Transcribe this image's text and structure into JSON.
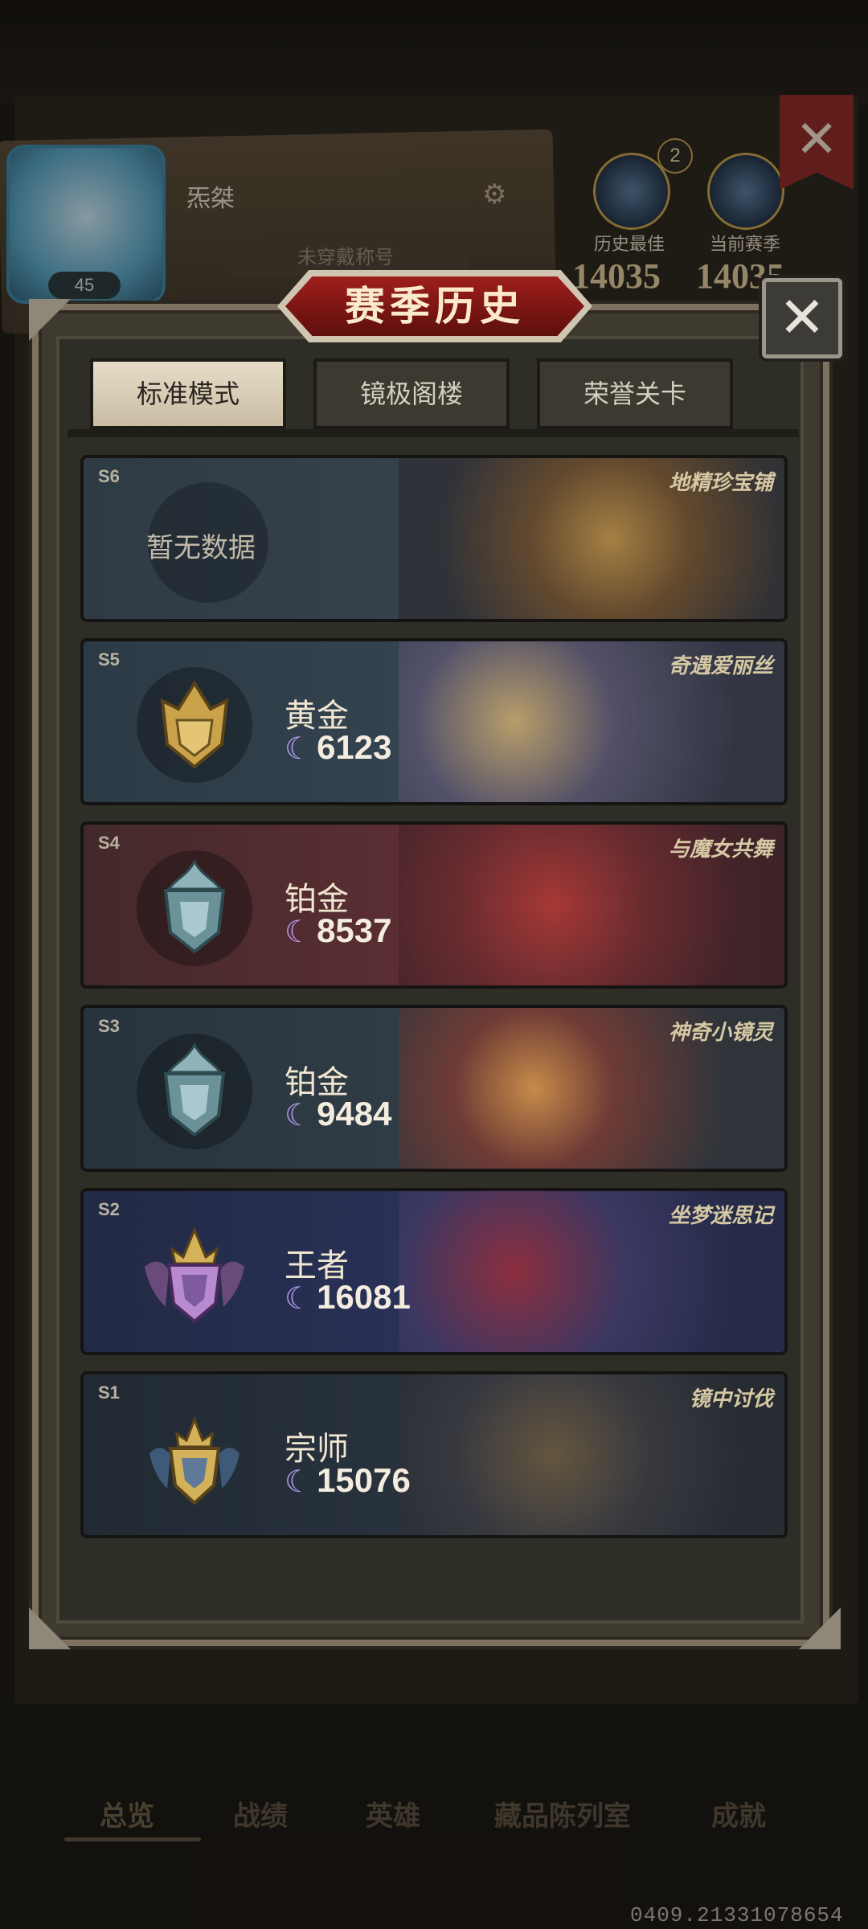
{
  "background": {
    "player_name": "炁桀",
    "title_placeholder": "未穿戴称号",
    "level": "45",
    "crown_count": "2",
    "history_best_label": "历史最佳",
    "current_season_label": "当前赛季",
    "history_best_score": "14035",
    "current_season_score": "14035",
    "nav": [
      "总览",
      "战绩",
      "英雄",
      "藏品陈列室",
      "成就"
    ],
    "build_number": "0409.21331078654"
  },
  "modal": {
    "title": "赛季历史",
    "close_icon": "close-icon",
    "tabs": [
      {
        "label": "标准模式",
        "active": true
      },
      {
        "label": "镜极阁楼",
        "active": false
      },
      {
        "label": "荣誉关卡",
        "active": false
      }
    ],
    "seasons": [
      {
        "season": "S6",
        "subtitle": "地精珍宝铺",
        "no_data": "暂无数据"
      },
      {
        "season": "S5",
        "subtitle": "奇遇爱丽丝",
        "rank": "黄金",
        "score": "6123",
        "emblem": "gold",
        "emblem_color": "#c9a24a"
      },
      {
        "season": "S4",
        "subtitle": "与魔女共舞",
        "rank": "铂金",
        "score": "8537",
        "emblem": "platinum",
        "emblem_color": "#8fb3b8"
      },
      {
        "season": "S3",
        "subtitle": "神奇小镜灵",
        "rank": "铂金",
        "score": "9484",
        "emblem": "platinum",
        "emblem_color": "#8fb3b8"
      },
      {
        "season": "S2",
        "subtitle": "坐梦迷思记",
        "rank": "王者",
        "score": "16081",
        "emblem": "king",
        "emblem_color": "#b88bd0"
      },
      {
        "season": "S1",
        "subtitle": "镜中讨伐",
        "rank": "宗师",
        "score": "15076",
        "emblem": "grandmaster",
        "emblem_color": "#d3b25a"
      }
    ],
    "score_icon": "crescent-moon-icon"
  }
}
